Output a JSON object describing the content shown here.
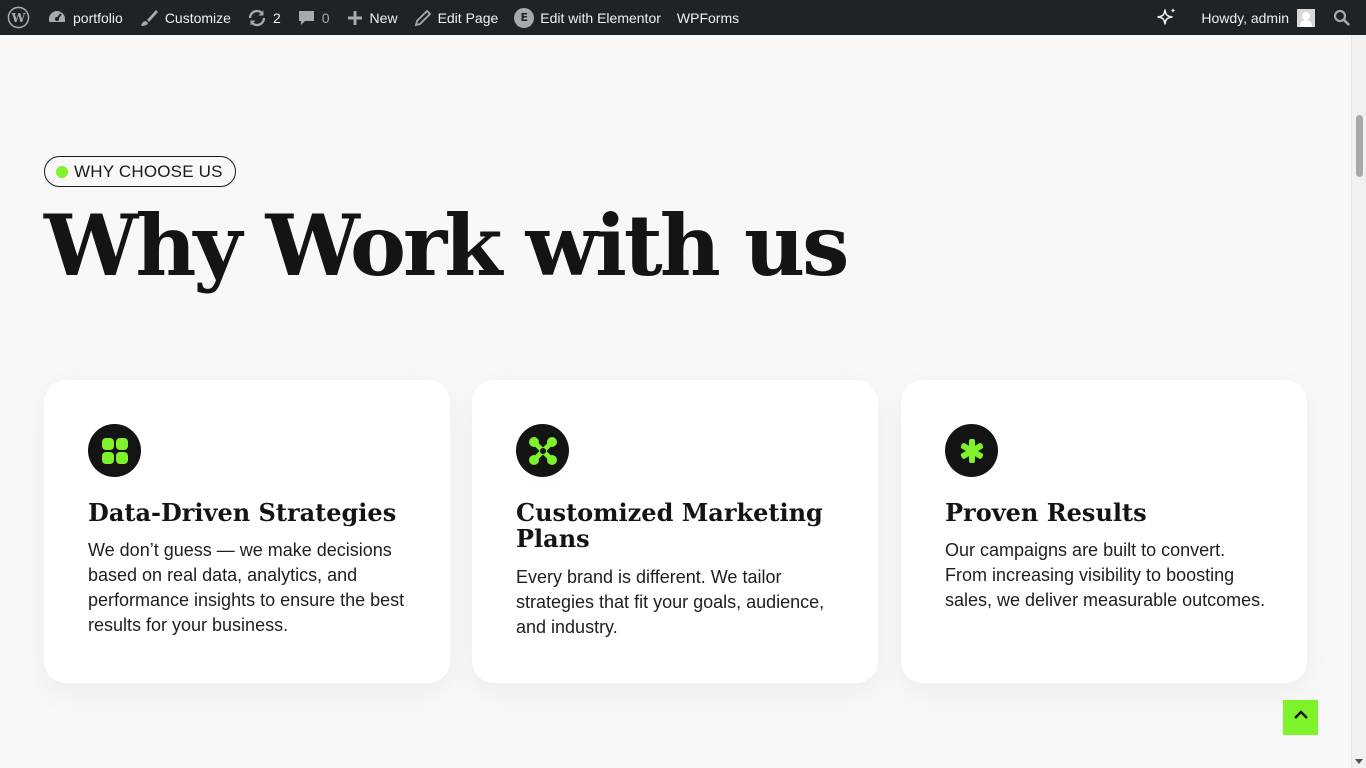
{
  "adminbar": {
    "site_name": "portfolio",
    "customize": "Customize",
    "updates_count": "2",
    "comments_count": "0",
    "new": "New",
    "edit_page": "Edit Page",
    "elementor": "Edit with Elementor",
    "elementor_badge": "E",
    "wpforms": "WPForms",
    "howdy": "Howdy, admin"
  },
  "section": {
    "tag": "WHY CHOOSE US",
    "heading": "Why Work with us"
  },
  "cards": [
    {
      "icon": "grid-clover-icon",
      "title": "Data-Driven Strategies",
      "description": "We don’t guess — we make decisions based on real data, analytics, and performance insights to ensure the best results for your business."
    },
    {
      "icon": "nodes-icon",
      "title": "Customized Marketing Plans",
      "description": "Every brand is different. We tailor strategies that fit your goals, audience, and industry."
    },
    {
      "icon": "asterisk-icon",
      "title": "Proven Results",
      "description": "Our campaigns are built to convert. From increasing visibility to boosting sales, we deliver measurable outcomes."
    }
  ],
  "colors": {
    "accent": "#7ef22a",
    "adminbar_bg": "#1d2327",
    "page_bg": "#f8f8f8",
    "dark": "#141414"
  }
}
